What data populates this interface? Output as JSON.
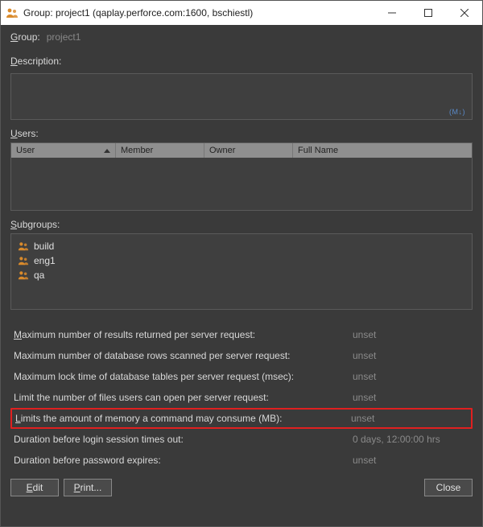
{
  "window": {
    "title": "Group: project1 (qaplay.perforce.com:1600,  bschiestl)"
  },
  "group_field": {
    "label_pre": "G",
    "label_rest": "roup:",
    "value": "project1"
  },
  "description": {
    "label_pre": "D",
    "label_rest": "escription:",
    "hint": "(M↓)"
  },
  "users": {
    "label_pre": "U",
    "label_rest": "sers:",
    "columns": {
      "user": "User",
      "member": "Member",
      "owner": "Owner",
      "full_name": "Full Name"
    }
  },
  "subgroups": {
    "label_pre": "S",
    "label_rest": "ubgroups:",
    "items": [
      {
        "name": "build"
      },
      {
        "name": "eng1"
      },
      {
        "name": "qa"
      }
    ]
  },
  "limits": [
    {
      "label_pre": "M",
      "label_rest": "aximum number of results returned per server request:",
      "value": "unset",
      "highlight": false
    },
    {
      "label_pre": "",
      "label_rest": "Maximum number of database rows scanned per server request:",
      "value": "unset",
      "highlight": false
    },
    {
      "label_pre": "",
      "label_rest": "Maximum lock time of database tables per server request (msec):",
      "value": "unset",
      "highlight": false
    },
    {
      "label_pre": "",
      "label_rest": "Limit the number of files users can open per server request:",
      "value": "unset",
      "highlight": false
    },
    {
      "label_pre": "L",
      "label_rest": "imits the amount of memory a command may consume (MB):",
      "value": "unset",
      "highlight": true
    },
    {
      "label_pre": "",
      "label_rest": "Duration before login session times out:",
      "value": "0 days, 12:00:00 hrs",
      "highlight": false
    },
    {
      "label_pre": "",
      "label_rest": "Duration before password expires:",
      "value": "unset",
      "highlight": false
    }
  ],
  "buttons": {
    "edit_pre": "E",
    "edit_rest": "dit",
    "print_pre": "P",
    "print_rest": "rint...",
    "close": "Close"
  }
}
